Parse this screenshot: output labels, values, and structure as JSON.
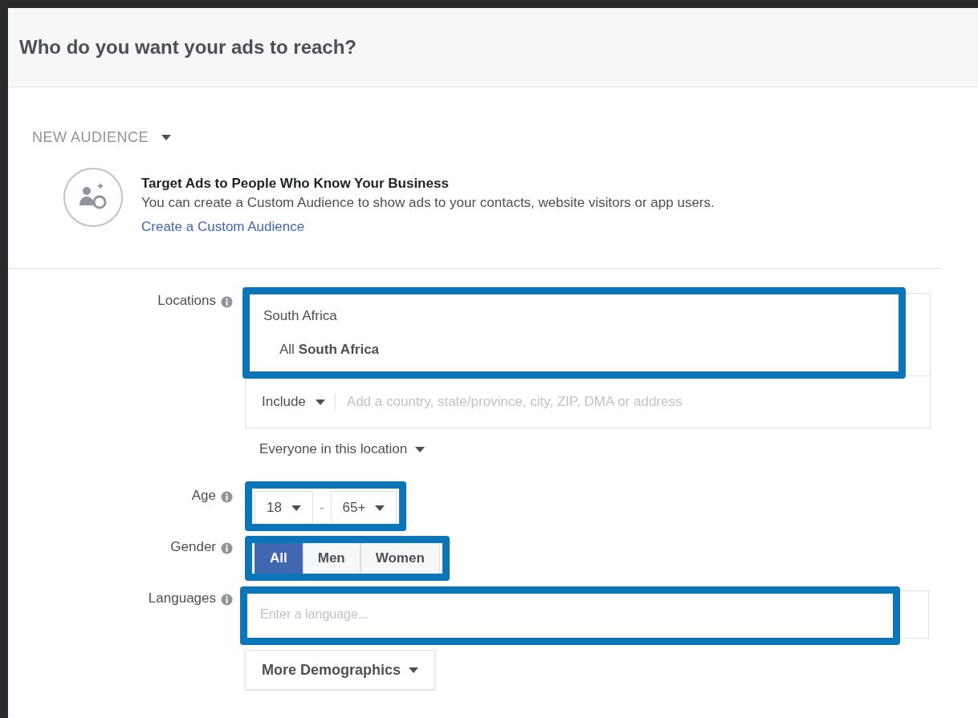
{
  "header": {
    "title": "Who do you want your ads to reach?"
  },
  "audience_selector": {
    "label": "NEW AUDIENCE"
  },
  "custom_audience_tip": {
    "title": "Target Ads to People Who Know Your Business",
    "text": "You can create a Custom Audience to show ads to your contacts, website visitors or app users.",
    "link": "Create a Custom Audience"
  },
  "locations": {
    "label": "Locations",
    "highlighted": true,
    "selected_country": "South Africa",
    "entries": [
      {
        "prefix": "All",
        "name": "South Africa"
      }
    ],
    "include_mode": "Include",
    "placeholder": "Add a country, state/province, city, ZIP, DMA or address",
    "scope": "Everyone in this location"
  },
  "age": {
    "label": "Age",
    "highlighted": true,
    "min": "18",
    "separator": "-",
    "max": "65+"
  },
  "gender": {
    "label": "Gender",
    "highlighted": true,
    "options": [
      {
        "label": "All",
        "selected": true
      },
      {
        "label": "Men",
        "selected": false
      },
      {
        "label": "Women",
        "selected": false
      }
    ]
  },
  "languages": {
    "label": "Languages",
    "highlighted": true,
    "placeholder": "Enter a language..."
  },
  "more_button": {
    "label": "More Demographics"
  }
}
